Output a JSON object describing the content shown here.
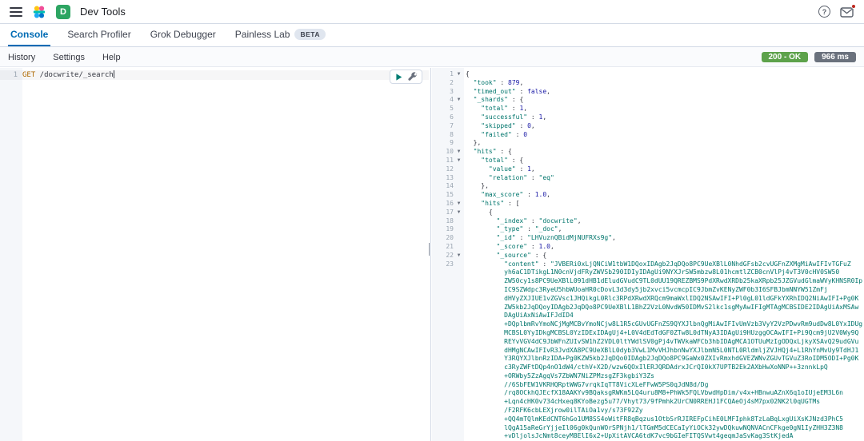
{
  "colors": {
    "accent_blue": "#006BB4",
    "status_badge_green": "#5DA24B",
    "time_badge_gray": "#6A717D",
    "space_badge_green": "#2DA562",
    "notification_red": "#BD271E",
    "method_orange": "#AD6800",
    "json_green": "#00756C",
    "json_number_blue": "#1A1AA6",
    "logo_palette": [
      "#FEC514",
      "#F04E98",
      "#00BFB3",
      "#1BA9F5",
      "#0077CC"
    ]
  },
  "header": {
    "title": "Dev Tools",
    "space_initial": "D",
    "icons": {
      "menu": "hamburger-menu",
      "help_glyph": "?",
      "newsfeed": "newsfeed"
    }
  },
  "tabs": [
    {
      "label": "Console",
      "active": true
    },
    {
      "label": "Search Profiler",
      "active": false
    },
    {
      "label": "Grok Debugger",
      "active": false
    },
    {
      "label": "Painless Lab",
      "active": false,
      "badge": "BETA"
    }
  ],
  "menu": {
    "links": [
      "History",
      "Settings",
      "Help"
    ],
    "status_badge": {
      "label": "200 - OK",
      "color": "#5DA24B"
    },
    "time_badge": {
      "label": "966 ms",
      "color": "#6A717D"
    }
  },
  "request": {
    "line_number": "1",
    "method": "GET",
    "url": " /docwrite/_search"
  },
  "response": {
    "fold_icon": "▼",
    "lines": [
      {
        "n": "1",
        "f": 1,
        "t": [
          [
            "p",
            "{"
          ]
        ]
      },
      {
        "n": "2",
        "f": 0,
        "t": [
          [
            "p",
            "  "
          ],
          [
            "k",
            "\"took\""
          ],
          [
            "p",
            " : "
          ],
          [
            "n",
            "879"
          ],
          [
            "p",
            ","
          ]
        ]
      },
      {
        "n": "3",
        "f": 0,
        "t": [
          [
            "p",
            "  "
          ],
          [
            "k",
            "\"timed_out\""
          ],
          [
            "p",
            " : "
          ],
          [
            "b",
            "false"
          ],
          [
            "p",
            ","
          ]
        ]
      },
      {
        "n": "4",
        "f": 1,
        "t": [
          [
            "p",
            "  "
          ],
          [
            "k",
            "\"_shards\""
          ],
          [
            "p",
            " : {"
          ]
        ]
      },
      {
        "n": "5",
        "f": 0,
        "t": [
          [
            "p",
            "    "
          ],
          [
            "k",
            "\"total\""
          ],
          [
            "p",
            " : "
          ],
          [
            "n",
            "1"
          ],
          [
            "p",
            ","
          ]
        ]
      },
      {
        "n": "6",
        "f": 0,
        "t": [
          [
            "p",
            "    "
          ],
          [
            "k",
            "\"successful\""
          ],
          [
            "p",
            " : "
          ],
          [
            "n",
            "1"
          ],
          [
            "p",
            ","
          ]
        ]
      },
      {
        "n": "7",
        "f": 0,
        "t": [
          [
            "p",
            "    "
          ],
          [
            "k",
            "\"skipped\""
          ],
          [
            "p",
            " : "
          ],
          [
            "n",
            "0"
          ],
          [
            "p",
            ","
          ]
        ]
      },
      {
        "n": "8",
        "f": 0,
        "t": [
          [
            "p",
            "    "
          ],
          [
            "k",
            "\"failed\""
          ],
          [
            "p",
            " : "
          ],
          [
            "n",
            "0"
          ]
        ]
      },
      {
        "n": "9",
        "f": 0,
        "t": [
          [
            "p",
            "  },"
          ]
        ]
      },
      {
        "n": "10",
        "f": 1,
        "t": [
          [
            "p",
            "  "
          ],
          [
            "k",
            "\"hits\""
          ],
          [
            "p",
            " : {"
          ]
        ]
      },
      {
        "n": "11",
        "f": 1,
        "t": [
          [
            "p",
            "    "
          ],
          [
            "k",
            "\"total\""
          ],
          [
            "p",
            " : {"
          ]
        ]
      },
      {
        "n": "12",
        "f": 0,
        "t": [
          [
            "p",
            "      "
          ],
          [
            "k",
            "\"value\""
          ],
          [
            "p",
            " : "
          ],
          [
            "n",
            "1"
          ],
          [
            "p",
            ","
          ]
        ]
      },
      {
        "n": "13",
        "f": 0,
        "t": [
          [
            "p",
            "      "
          ],
          [
            "k",
            "\"relation\""
          ],
          [
            "p",
            " : "
          ],
          [
            "s",
            "\"eq\""
          ]
        ]
      },
      {
        "n": "14",
        "f": 0,
        "t": [
          [
            "p",
            "    },"
          ]
        ]
      },
      {
        "n": "15",
        "f": 0,
        "t": [
          [
            "p",
            "    "
          ],
          [
            "k",
            "\"max_score\""
          ],
          [
            "p",
            " : "
          ],
          [
            "n",
            "1.0"
          ],
          [
            "p",
            ","
          ]
        ]
      },
      {
        "n": "16",
        "f": 1,
        "t": [
          [
            "p",
            "    "
          ],
          [
            "k",
            "\"hits\""
          ],
          [
            "p",
            " : ["
          ]
        ]
      },
      {
        "n": "17",
        "f": 1,
        "t": [
          [
            "p",
            "      {"
          ]
        ]
      },
      {
        "n": "18",
        "f": 0,
        "t": [
          [
            "p",
            "        "
          ],
          [
            "k",
            "\"_index\""
          ],
          [
            "p",
            " : "
          ],
          [
            "s",
            "\"docwrite\""
          ],
          [
            "p",
            ","
          ]
        ]
      },
      {
        "n": "19",
        "f": 0,
        "t": [
          [
            "p",
            "        "
          ],
          [
            "k",
            "\"_type\""
          ],
          [
            "p",
            " : "
          ],
          [
            "s",
            "\"_doc\""
          ],
          [
            "p",
            ","
          ]
        ]
      },
      {
        "n": "20",
        "f": 0,
        "t": [
          [
            "p",
            "        "
          ],
          [
            "k",
            "\"_id\""
          ],
          [
            "p",
            " : "
          ],
          [
            "s",
            "\"LHVuznQBidMjNUFRXs9g\""
          ],
          [
            "p",
            ","
          ]
        ]
      },
      {
        "n": "21",
        "f": 0,
        "t": [
          [
            "p",
            "        "
          ],
          [
            "k",
            "\"_score\""
          ],
          [
            "p",
            " : "
          ],
          [
            "n",
            "1.0"
          ],
          [
            "p",
            ","
          ]
        ]
      },
      {
        "n": "22",
        "f": 1,
        "t": [
          [
            "p",
            "        "
          ],
          [
            "k",
            "\"_source\""
          ],
          [
            "p",
            " : {"
          ]
        ]
      }
    ],
    "content_line": {
      "n": "23",
      "key": "\"content\"",
      "sep": " : ",
      "value_open": "\"",
      "lines": [
        "JVBERi0xLjQNCiW1tbW1DQoxIDAgb2JqDQo8PC9UeXBlL0NhdGFsb2cvUGFnZXMgMiAwIFIvTGFuZ",
        "yh6aC1DTikgL1N0cnVjdFRyZWVSb290IDIyIDAgUi9NYXJrSW5mbzw8L01hcmtlZCB0cnVlPj4vT3V0cHV0SW50",
        "ZW50cy1s8PC9UeXBlL091dHB1dEludGVudC9TL0dUU19QREZBMS9PdXRwdXRDb25kaXRpb25JZGVudGlmaWVyKHNSR0Ip",
        "IC9SZWdpc3RyeU5hbWUoaHR0cDovL3d3dy5jb2xvci5vcmcpIC9JbmZvKENyZWF0b3I6SFBJbmNNYW51ZmFj",
        "dHVyZXJIUE1vZGVsc1JHQikgL0Rlc3RPdXRwdXRQcm9maWxlIDQ2NSAwIFI+Pl0gL01ldGFkYXRhIDQ2NiAwIFI+Pg0K",
        "ZW5kb2JqDQoyIDAgb2JqDQo8PC9UeXBlL1BhZ2VzL0NvdW50IDMvS2lkc1sgMyAwIFIgMTAgMCBSIDE2IDAgUiAxMSAw",
        "DAgUiAxNiAwIFJdID4",
        "+DQplbmRvYmoNCjMgMCBvYmoNCjw8L1R5cGUvUGFnZS9QYXJlbnQgMiAwIFIvUmVzb3VyY2VzPDwvRm9udDw8L0YxIDUg",
        "MCBSL0YyIDkgMCBSL0YzIDExIDAgUj4+L0V4dEdTdGF0ZTw8L0dTNyA3IDAgUi9HUzggOCAwIFI+Pi9Qcm9jU2V0Wy9Q",
        "REYvVGV4dC9JbWFnZUIvSW1hZ2VDL0ltYWdlSV0gPj4vTWVkaWFCb3hbIDAgMCA1OTUuMzIgODQxLjkyXSAvQ29udGVu",
        "dHMgNCAwIFIvR3JvdXA8PC9UeXBlL0dyb3VwL1MvVHJhbnNwYXJlbmN5L0NTL0RldmljZVJHQj4+L1RhYnMvUy9TdHJ1",
        "Y3RQYXJlbnRzIDA+Pg0KZW5kb2JqDQo0IDAgb2JqDQo8PC9GaWx0ZXIvRmxhdGVEZWNvZGUvTGVuZ3RoIDM5ODI+Pg0K",
        "c3RyZWFtDQp4nO1dW4/cthV+X2D/wzw6QOxIlERJQRDAdrxJCrQI0kX7UPTB2Ek2AXbHwXoNNP++3znnkLpQ",
        "+ORWby5ZzAgqVs7ZbWN7NiZPMzsgZF3kgbiY3Zs",
        "//6SbFEW1VKRHQRptWWG7vrqkIqTT8VicXLeFFwW5PS0qJdN8d/Dg",
        "/rq8OCkhQJEcfX18AAKYv9BQaksgRWKm5LQ4uru8M8+PhWk5FQLVbwdHpDim/v4x+HBnwuAZnX6q1oIUjeEM3L6n",
        "+Lqn4cHK0v734cHxeq8KYoBezg5u77/Vhyt73/9fPmhk2UrCN0RREHJ1FCQAeOj4sM7px02NK2l0qUGTMs",
        "/F2RFK6cbLEXjrow0ilTAiOa1vy/s73F92Zy",
        "+QQ4mTQlmKEdCNT6hGo1UM8SS4oWitFR8qBqzus1OtbSrRJIREFpCihE0LMFIphk8TzLaBqLxgUiXsKJNzd3PhC5",
        "lQgA15aReGrYjjeIl06g0kQunWOrSPNjh1/lTGmM5dCECaIyYiOCk32ywDQkuwNQNVACnCFkge0gN1IyZHH3Z3N8",
        "+vDljolsJcNmt8ceyM8ElI6x2+UpXitAVCA6tdK7vc9bGIeFITQSVwt4geqmJaSvKag3StKjedA"
      ]
    }
  }
}
